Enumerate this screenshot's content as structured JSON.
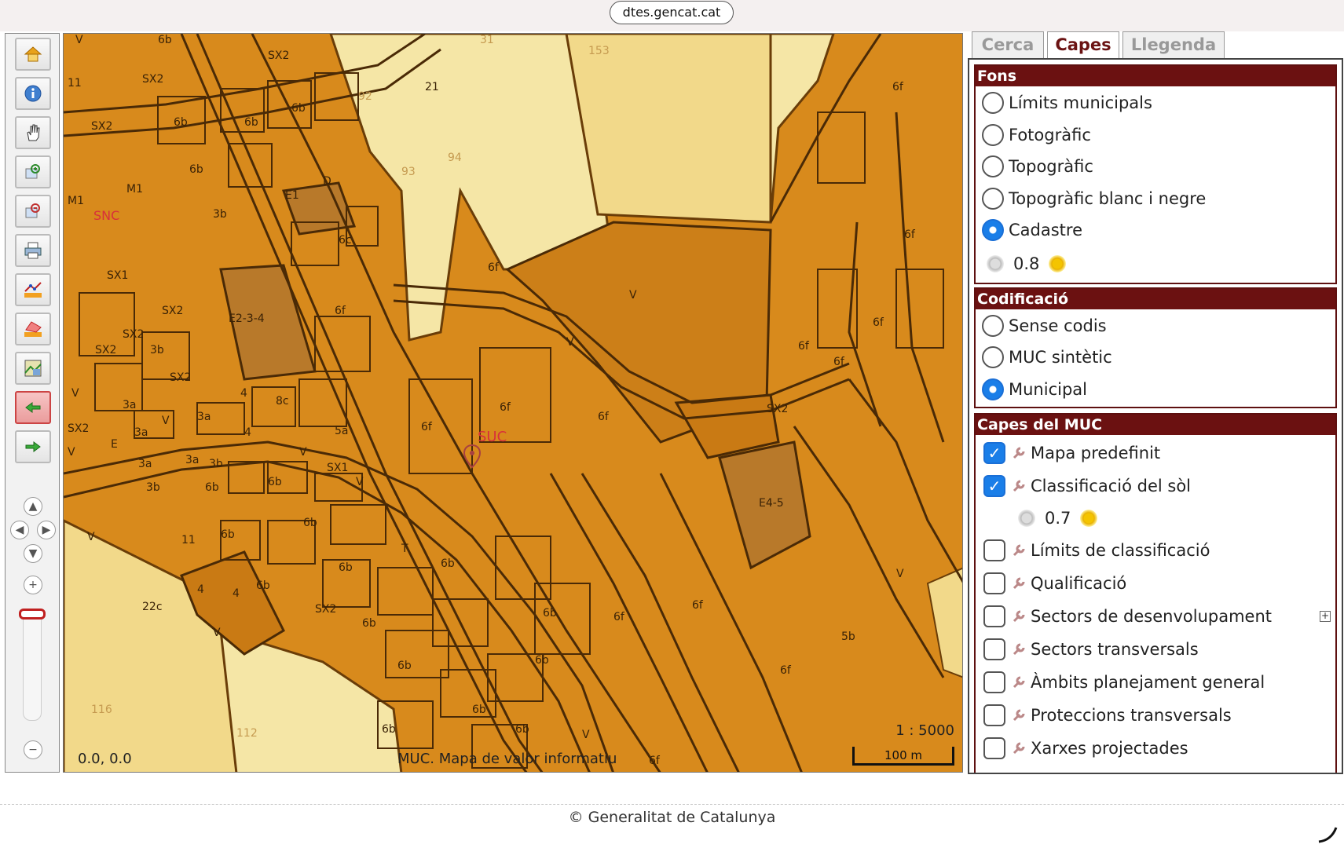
{
  "browser": {
    "url": "dtes.gencat.cat"
  },
  "toolbar": {
    "tools": [
      "home-icon",
      "info-icon",
      "pan-hand-icon",
      "zoom-in-box-icon",
      "zoom-out-box-icon",
      "print-icon",
      "measure-line-icon",
      "measure-area-icon",
      "map-layer-icon",
      "previous-view-icon",
      "next-view-icon"
    ],
    "nav": {
      "up": "▲",
      "left": "◀",
      "right": "▶",
      "down": "▼",
      "zoom_in": "+",
      "zoom_out": "−"
    }
  },
  "map": {
    "coordinates": "0.0, 0.0",
    "attribution": "MUC. Mapa de valor informatiu",
    "scale_ratio": "1 : 5000",
    "scale_bar_label": "100 m",
    "labels": {
      "snc": "SNC",
      "suc": "SUC",
      "v": "V",
      "sx2": "SX2",
      "sx1": "SX1",
      "m1": "M1",
      "n11": "11",
      "n21": "21",
      "n4": "4",
      "e1": "E1",
      "d": "D",
      "e234": "E2-3-4",
      "e45": "E4-5",
      "t": "T",
      "e": "E",
      "l3a": "3a",
      "l3b": "3b",
      "l5a": "5a",
      "l5b": "5b",
      "l6b": "6b",
      "l6c": "6c",
      "l6f": "6f",
      "l8c": "8c",
      "l22c": "22c",
      "n31": "31",
      "n92": "92",
      "n94": "94",
      "n93": "93",
      "n153": "153",
      "n112": "112",
      "n116": "116"
    }
  },
  "panel": {
    "tabs": [
      "Cerca",
      "Capes",
      "Llegenda"
    ],
    "active_tab": "Capes",
    "fons": {
      "title": "Fons",
      "options": [
        "Límits municipals",
        "Fotogràfic",
        "Topogràfic",
        "Topogràfic blanc i negre",
        "Cadastre"
      ],
      "selected": "Cadastre",
      "opacity": "0.8"
    },
    "codificacio": {
      "title": "Codificació",
      "options": [
        "Sense codis",
        "MUC sintètic",
        "Municipal"
      ],
      "selected": "Municipal"
    },
    "capes": {
      "title": "Capes del MUC",
      "layers": [
        {
          "label": "Mapa predefinit",
          "checked": true
        },
        {
          "label": "Classificació del sòl",
          "checked": true
        },
        {
          "label": "Límits de classificació",
          "checked": false
        },
        {
          "label": "Qualificació",
          "checked": false
        },
        {
          "label": "Sectors de desenvolupament",
          "checked": false
        },
        {
          "label": "Sectors transversals",
          "checked": false
        },
        {
          "label": "Àmbits planejament general",
          "checked": false
        },
        {
          "label": "Proteccions transversals",
          "checked": false
        },
        {
          "label": "Xarxes projectades",
          "checked": false
        }
      ],
      "classificacio_opacity": "0.7",
      "expand_symbol": "+"
    }
  },
  "footer": {
    "copyright": "© Generalitat de Catalunya"
  },
  "colors": {
    "urban_orange": "#d88a1c",
    "light_yellow": "#f2d98a",
    "pale_yellow": "#f5e6a6",
    "dark_orange": "#c97a14",
    "brown_parcel": "#b8792a",
    "panel_header": "#6b1111",
    "active_blue": "#1a7ee8"
  }
}
